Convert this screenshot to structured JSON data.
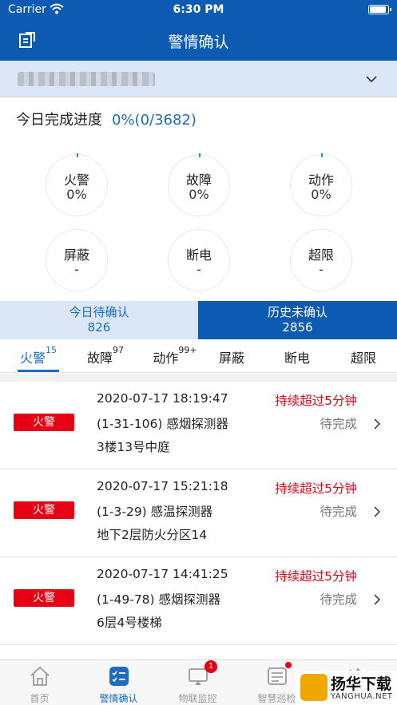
{
  "status_bar": {
    "carrier": "Carrier",
    "time": "6:30 PM"
  },
  "nav": {
    "title": "警情确认"
  },
  "progress": {
    "label": "今日完成进度",
    "value": "0%(0/3682)"
  },
  "stats": [
    {
      "name": "火警",
      "value": "0%"
    },
    {
      "name": "故障",
      "value": "0%"
    },
    {
      "name": "动作",
      "value": "0%"
    },
    {
      "name": "屏蔽",
      "value": "-"
    },
    {
      "name": "断电",
      "value": "-"
    },
    {
      "name": "超限",
      "value": "-"
    }
  ],
  "confirm_tabs": [
    {
      "label": "今日待确认",
      "count": "826"
    },
    {
      "label": "历史未确认",
      "count": "2856"
    }
  ],
  "categories": [
    {
      "label": "火警",
      "count": "15"
    },
    {
      "label": "故障",
      "count": "97"
    },
    {
      "label": "动作",
      "count": "99+"
    },
    {
      "label": "屏蔽",
      "count": ""
    },
    {
      "label": "断电",
      "count": ""
    },
    {
      "label": "超限",
      "count": ""
    }
  ],
  "alarms": [
    {
      "type": "火警",
      "datetime": "2020-07-17 18:19:47",
      "device": "(1-31-106)  感烟探测器",
      "location": "3楼13号中庭",
      "warning": "持续超过5分钟",
      "status": "待完成"
    },
    {
      "type": "火警",
      "datetime": "2020-07-17 15:21:18",
      "device": "(1-3-29)  感温探测器",
      "location": "地下2层防火分区14",
      "warning": "持续超过5分钟",
      "status": "待完成"
    },
    {
      "type": "火警",
      "datetime": "2020-07-17 14:41:25",
      "device": "(1-49-78)  感烟探测器",
      "location": "6层4号楼梯",
      "warning": "持续超过5分钟",
      "status": "待完成"
    }
  ],
  "tabbar": [
    {
      "label": "首页",
      "icon": "home-icon"
    },
    {
      "label": "警情确认",
      "icon": "checklist-icon"
    },
    {
      "label": "物联监控",
      "icon": "monitor-icon",
      "badge": "1"
    },
    {
      "label": "智慧巡检",
      "icon": "inspection-icon"
    },
    {
      "label": "",
      "icon": "tools-icon"
    }
  ],
  "watermark": {
    "title": "扬华下载",
    "url": "YANGHUA.NET"
  },
  "colors": {
    "primary": "#0d5ab3",
    "accent": "#1d6cc2",
    "alert": "#e60012",
    "light": "#dbe6f6"
  }
}
